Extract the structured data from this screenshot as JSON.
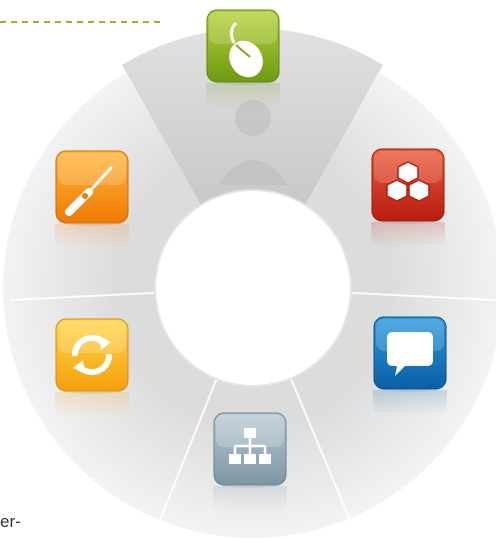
{
  "header": {
    "dashes_color": "#8dbb2a"
  },
  "wheel": {
    "ring_color": "#eeeeee",
    "highlight_segment": "top",
    "tiles": [
      {
        "id": "mouse",
        "icon": "mouse-icon",
        "color_top": "#b6d33a",
        "color_bottom": "#6f9a14",
        "active": true
      },
      {
        "id": "modules",
        "icon": "cubes-icon",
        "color_top": "#ec5a3a",
        "color_bottom": "#b51d10"
      },
      {
        "id": "chat",
        "icon": "speech-bubble-icon",
        "color_top": "#2b98dc",
        "color_bottom": "#0b5fa6"
      },
      {
        "id": "network",
        "icon": "network-hierarchy-icon",
        "color_top": "#b9cbd5",
        "color_bottom": "#7d95a3"
      },
      {
        "id": "sync",
        "icon": "refresh-arrows-icon",
        "color_top": "#ffd54a",
        "color_bottom": "#f3a10c"
      },
      {
        "id": "tools",
        "icon": "screwdriver-icon",
        "color_top": "#ffb637",
        "color_bottom": "#f07a06"
      }
    ]
  },
  "footer": {
    "partial_text": "er-"
  }
}
